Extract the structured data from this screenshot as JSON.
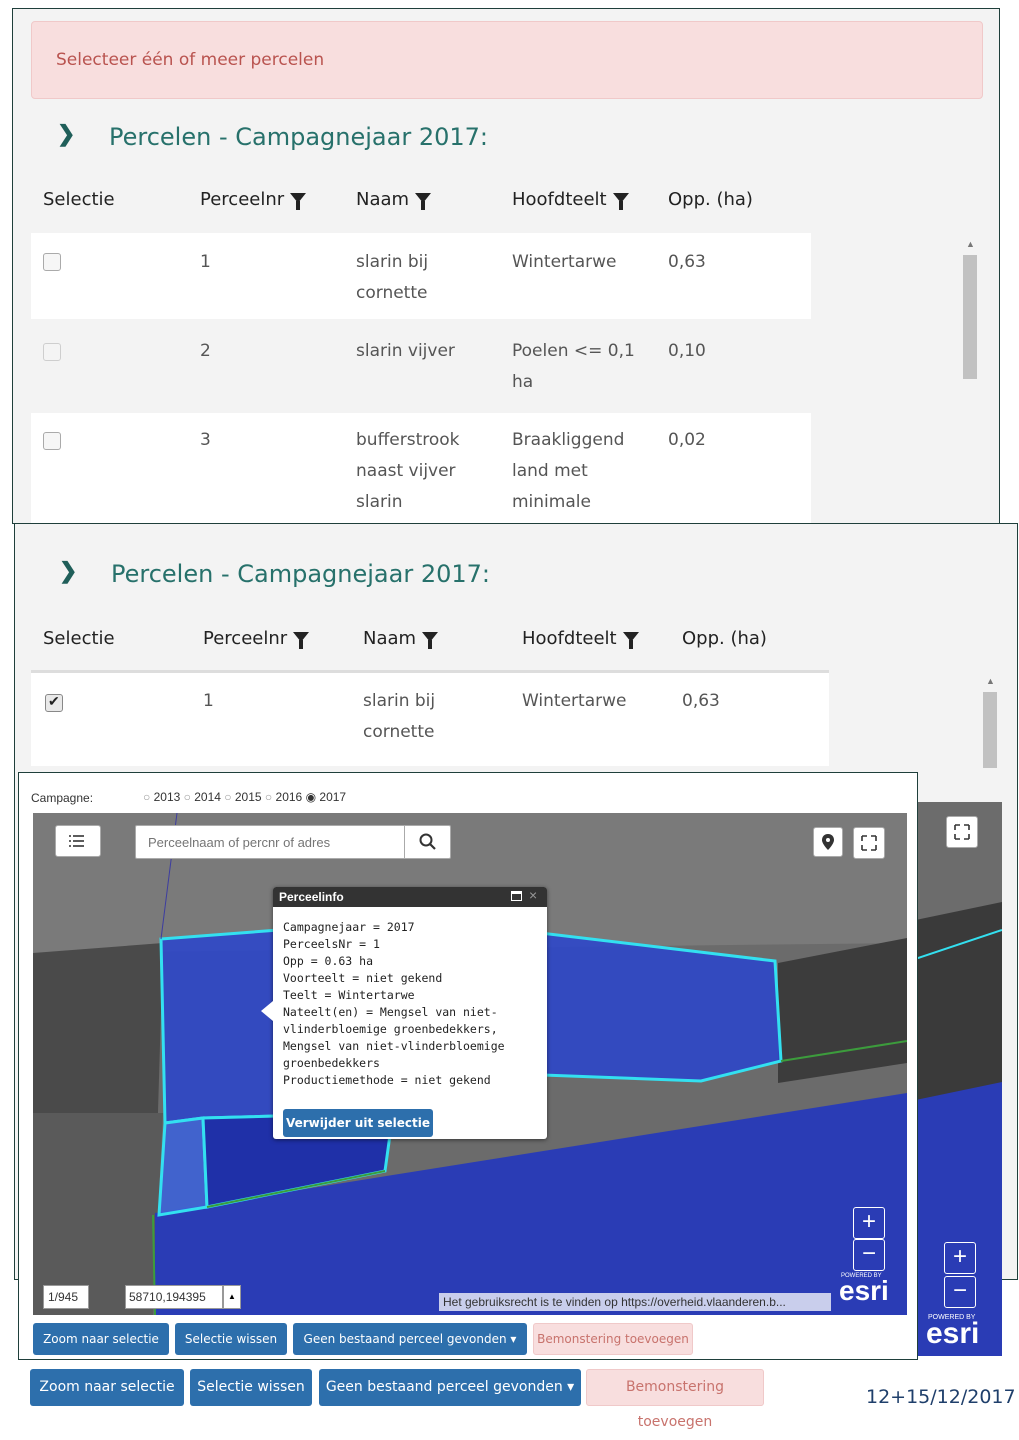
{
  "alert": {
    "text": "Selecteer één of meer percelen"
  },
  "section": {
    "title": "Percelen - Campagnejaar 2017:"
  },
  "table": {
    "headers": [
      "Selectie",
      "Perceelnr",
      "Naam",
      "Hoofdteelt",
      "Opp. (ha)"
    ],
    "rows_top": [
      {
        "nr": "1",
        "naam": [
          "slarin bij",
          "cornette"
        ],
        "teelt": [
          "Wintertarwe"
        ],
        "opp": "0,63",
        "checkbox": "unchecked"
      },
      {
        "nr": "2",
        "naam": [
          "slarin vijver"
        ],
        "teelt": [
          "Poelen <= 0,1",
          "ha"
        ],
        "opp": "0,10",
        "checkbox": "disabled"
      },
      {
        "nr": "3",
        "naam": [
          "bufferstrook",
          "naast vijver",
          "slarin"
        ],
        "teelt": [
          "Braakliggend",
          "land met",
          "minimale"
        ],
        "opp": "0,02",
        "checkbox": "unchecked"
      }
    ],
    "rows_bottom": [
      {
        "nr": "1",
        "naam": [
          "slarin bij",
          "cornette"
        ],
        "teelt": [
          "Wintertarwe"
        ],
        "opp": "0,63",
        "checkbox": "checked"
      }
    ]
  },
  "campagne": {
    "label": "Campagne:",
    "years": [
      "2013",
      "2014",
      "2015",
      "2016",
      "2017"
    ],
    "selected": "2017"
  },
  "map": {
    "search_placeholder": "Perceelnaam of percnr of adres",
    "popup": {
      "title": "Perceelinfo",
      "lines": [
        "Campagnejaar = 2017",
        "PerceelsNr = 1",
        "Opp = 0.63 ha",
        "Voorteelt = niet gekend",
        "Teelt = Wintertarwe",
        "Nateelt(en) = Mengsel van niet-",
        "vlinderbloemige groenbedekkers,",
        "Mengsel van niet-vlinderbloemige",
        "groenbedekkers",
        "Productiemethode = niet gekend"
      ],
      "button": "Verwijder uit selectie"
    },
    "scale": "1/945",
    "coords": "58710,194395",
    "attribution": "Het gebruiksrecht is te vinden op https://overheid.vlaanderen.b...",
    "esri_powered": "POWERED BY",
    "esri_logo": "esri",
    "zoom_in": "+",
    "zoom_out": "−",
    "icons": [
      "list-icon",
      "search-icon",
      "location-pin-icon",
      "fullscreen-icon"
    ]
  },
  "buttons": {
    "zoom": "Zoom naar selectie",
    "clear": "Selectie wissen",
    "dropdown": "Geen bestaand perceel gevonden",
    "sample": "Bemonstering toevoegen"
  },
  "footer_date": "12+15/12/2017",
  "colors": {
    "teal": "#27716b",
    "blue_button": "#2d6fac",
    "alert_bg": "#f8dede",
    "parcel_outline": "#33e0f0"
  }
}
